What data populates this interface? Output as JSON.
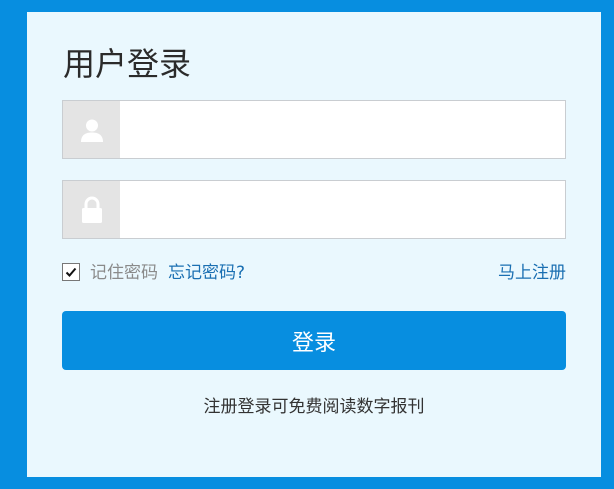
{
  "login_panel": {
    "title": "用户登录",
    "username": {
      "value": "",
      "placeholder": "",
      "icon": "user-icon"
    },
    "password": {
      "value": "",
      "placeholder": "",
      "icon": "lock-icon"
    },
    "remember": {
      "checked": true,
      "label": "记住密码"
    },
    "forgot_password_label": "忘记密码?",
    "register_label": "马上注册",
    "login_button_label": "登录",
    "note": "注册登录可免费阅读数字报刊"
  },
  "colors": {
    "brand_blue": "#078ee0",
    "panel_bg": "#eaf8fe",
    "link_blue": "#1a6fb2",
    "icon_bg": "#e4e4e4"
  }
}
